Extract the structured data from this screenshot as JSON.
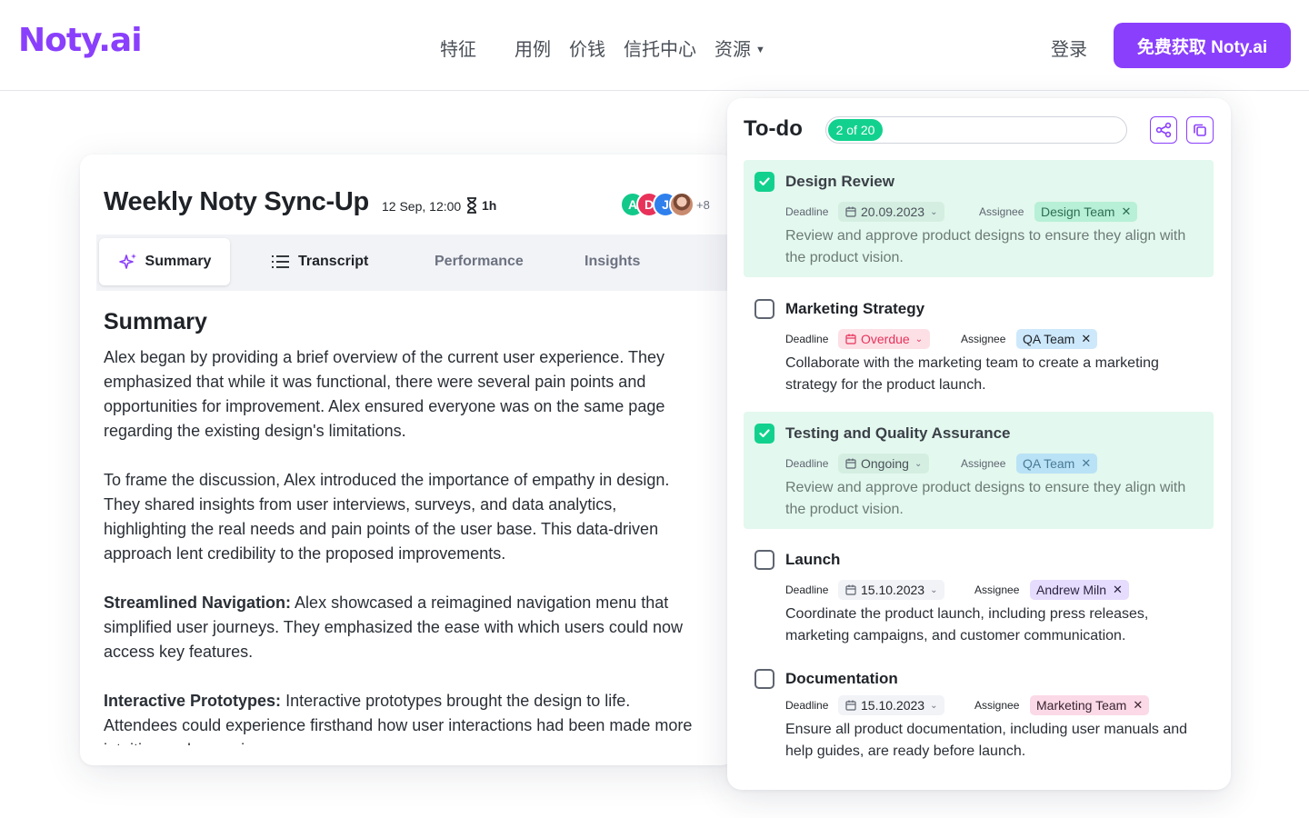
{
  "header": {
    "logo": "Noty.ai",
    "nav": [
      "特征",
      "用例",
      "价钱",
      "信托中心",
      "资源"
    ],
    "login": "登录",
    "cta": "免费获取 Noty.ai"
  },
  "meeting": {
    "title": "Weekly Noty Sync-Up",
    "date": "12 Sep, 12:00",
    "duration": "1h",
    "avatars": [
      {
        "initial": "A",
        "color": "#12c98a"
      },
      {
        "initial": "D",
        "color": "#e8325a"
      },
      {
        "initial": "J",
        "color": "#2f80ed"
      }
    ],
    "more_attendees": "+8",
    "tabs": [
      "Summary",
      "Transcript",
      "Performance",
      "Insights"
    ],
    "summary_heading": "Summary",
    "paragraphs": [
      {
        "bold": "",
        "text": "Alex began by providing a brief overview of the current user experience. They emphasized that while it was functional, there were several pain points and opportunities for improvement. Alex ensured everyone was on the same page regarding the existing design's limitations."
      },
      {
        "bold": "",
        "text": "To frame the discussion, Alex introduced the importance of empathy in design. They shared insights from user interviews, surveys, and data analytics, highlighting the real needs and pain points of the user base. This data-driven approach lent credibility to the proposed improvements."
      },
      {
        "bold": "Streamlined Navigation:",
        "text": " Alex showcased a reimagined navigation menu that simplified user journeys. They emphasized the ease with which users could now access key features."
      },
      {
        "bold": "Interactive Prototypes:",
        "text": " Interactive prototypes brought the design to life. Attendees could experience firsthand how user interactions had been made more intuitive and engaging."
      }
    ]
  },
  "todo": {
    "title": "To-do",
    "progress_label": "2 of 20",
    "progress_done": 2,
    "progress_total": 20,
    "deadline_label": "Deadline",
    "assignee_label": "Assignee",
    "tasks": [
      {
        "name": "Design Review",
        "done": true,
        "deadline": "20.09.2023",
        "deadline_style": "date",
        "assignee": "Design Team",
        "assignee_color": "green",
        "desc": "Review and approve product designs to ensure they align with the product vision."
      },
      {
        "name": "Marketing Strategy",
        "done": false,
        "deadline": "Overdue",
        "deadline_style": "overdue",
        "assignee": "QA Team",
        "assignee_color": "blue",
        "desc": "Collaborate with the marketing team to create a marketing strategy for the product launch."
      },
      {
        "name": "Testing and Quality Assurance",
        "done": true,
        "deadline": "Ongoing",
        "deadline_style": "date",
        "assignee": "QA Team",
        "assignee_color": "blue",
        "desc": "Review and approve product designs to ensure they align with the product vision."
      },
      {
        "name": "Launch",
        "done": false,
        "deadline": "15.10.2023",
        "deadline_style": "date",
        "assignee": "Andrew Miln",
        "assignee_color": "purple",
        "desc": "Coordinate the product launch, including press releases, marketing campaigns, and customer communication."
      },
      {
        "name": "Documentation",
        "done": false,
        "deadline": "15.10.2023",
        "deadline_style": "date",
        "assignee": "Marketing Team",
        "assignee_color": "pink",
        "desc": "Ensure all product documentation, including user manuals and help guides, are ready before launch."
      }
    ]
  }
}
